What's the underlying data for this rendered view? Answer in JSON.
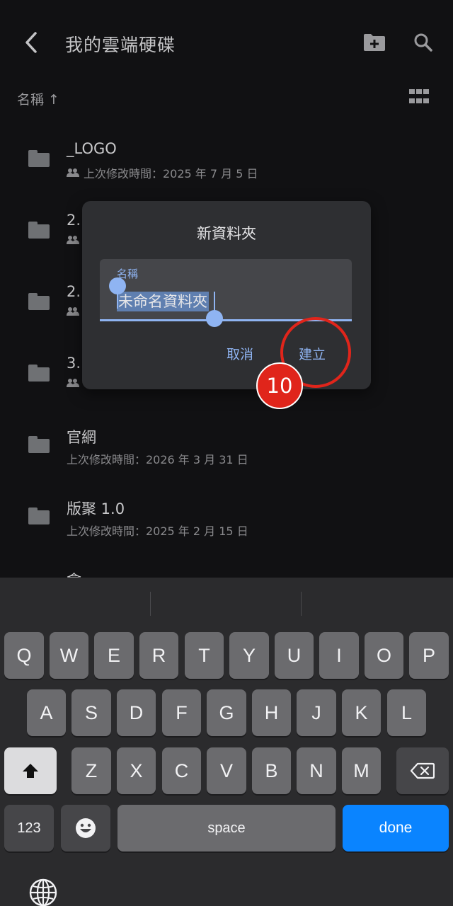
{
  "header": {
    "title": "我的雲端硬碟",
    "back_icon": "chevron-left-icon",
    "new_folder_icon": "folder-plus-icon",
    "search_icon": "search-icon"
  },
  "sortbar": {
    "label": "名稱 ↑",
    "view_icon": "grid-view-icon"
  },
  "files": [
    {
      "name": "_LOGO",
      "meta": "上次修改時間：2025 年 7 月 5 日",
      "shared": true
    },
    {
      "name": "2.",
      "meta": "",
      "shared": true
    },
    {
      "name": "2.",
      "meta": "",
      "shared": true
    },
    {
      "name": "3.",
      "meta": "",
      "shared": true
    },
    {
      "name": "官網",
      "meta": "上次修改時間：2026 年 3 月 31 日",
      "shared": false
    },
    {
      "name": "版聚 1.0",
      "meta": "上次修改時間：2025 年 2 月 15 日",
      "shared": false
    },
    {
      "name": "會",
      "meta": "",
      "shared": false
    }
  ],
  "dialog": {
    "title": "新資料夾",
    "field_label": "名稱",
    "field_value": "未命名資料夾",
    "cancel_label": "取消",
    "create_label": "建立"
  },
  "annotation": {
    "step_number": "10",
    "color": "#e0251b"
  },
  "keyboard": {
    "row1": [
      "Q",
      "W",
      "E",
      "R",
      "T",
      "Y",
      "U",
      "I",
      "O",
      "P"
    ],
    "row2": [
      "A",
      "S",
      "D",
      "F",
      "G",
      "H",
      "J",
      "K",
      "L"
    ],
    "row3": [
      "Z",
      "X",
      "C",
      "V",
      "B",
      "N",
      "M"
    ],
    "numbers_label": "123",
    "space_label": "space",
    "done_label": "done",
    "shift_icon": "shift-icon",
    "backspace_icon": "backspace-icon",
    "emoji_icon": "emoji-icon",
    "globe_icon": "globe-icon"
  },
  "colors": {
    "accent": "#8fb4f2",
    "done": "#0a84ff",
    "background": "#111113"
  }
}
